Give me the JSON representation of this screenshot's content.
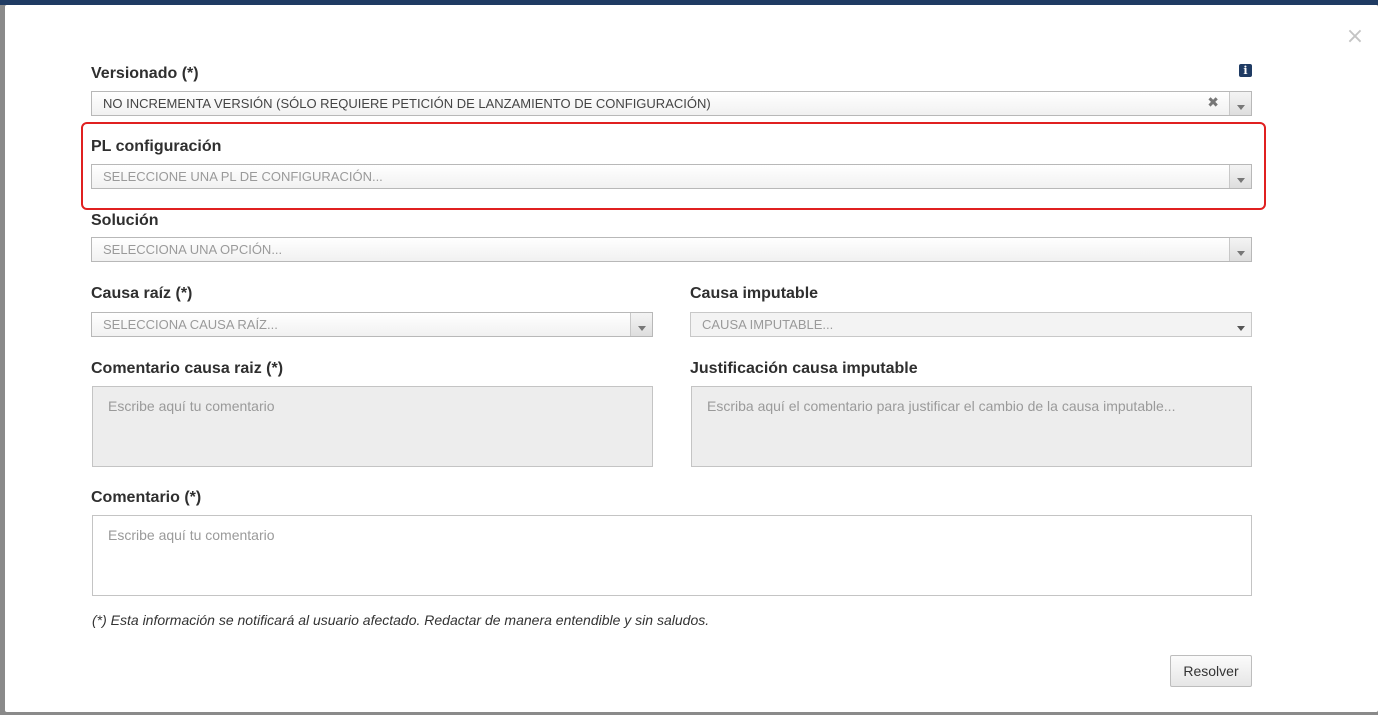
{
  "modal": {
    "close_glyph": "×"
  },
  "versionado": {
    "label": "Versionado (*)",
    "value": "NO INCREMENTA VERSIÓN (SÓLO REQUIERE PETICIÓN DE LANZAMIENTO DE CONFIGURACIÓN)",
    "clear_glyph": "✖",
    "info_glyph": "i"
  },
  "pl_configuracion": {
    "label": "PL configuración",
    "placeholder": "SELECCIONE UNA PL DE CONFIGURACIÓN..."
  },
  "solucion": {
    "label": "Solución",
    "placeholder": "SELECCIONA UNA OPCIÓN..."
  },
  "causa_raiz": {
    "label": "Causa raíz (*)",
    "placeholder": "SELECCIONA CAUSA RAÍZ..."
  },
  "causa_imputable": {
    "label": "Causa imputable",
    "placeholder": "CAUSA IMPUTABLE..."
  },
  "comentario_causa_raiz": {
    "label": "Comentario causa raiz (*)",
    "placeholder": "Escribe aquí tu comentario"
  },
  "justificacion_causa_imputable": {
    "label": "Justificación causa imputable",
    "placeholder": "Escriba aquí el comentario para justificar el cambio de la causa imputable..."
  },
  "comentario": {
    "label": "Comentario (*)",
    "placeholder": "Escribe aquí tu comentario"
  },
  "footnote": "(*) Esta información se notificará al usuario afectado. Redactar de manera entendible y sin saludos.",
  "actions": {
    "submit_label": "Resolver"
  },
  "colors": {
    "highlight": "#e02020",
    "info_icon_bg": "#1f3b63"
  }
}
